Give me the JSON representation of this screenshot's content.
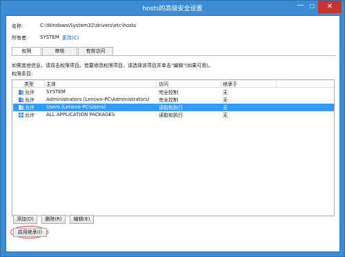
{
  "window": {
    "title": "hosts的高级安全设置",
    "close_label": "✕",
    "min_label": "—",
    "max_label": "☐"
  },
  "header": {
    "name_label": "名称:",
    "name_value": "C:\\Windows\\System32\\drivers\\etc\\hosts",
    "owner_label": "所有者:",
    "owner_value": "SYSTEM",
    "change_link": "更改(C)"
  },
  "tabs": [
    {
      "label": "权限"
    },
    {
      "label": "审核"
    },
    {
      "label": "有效访问"
    }
  ],
  "info_text": "如需其他信息，请双击权限项目。若要修改权限项目，请选择该项目并单击\"编辑\"(如果可用)。",
  "entries_label": "权限条目:",
  "columns": [
    "类型",
    "主体",
    "访问",
    "继承于"
  ],
  "rows": [
    {
      "type": "允许",
      "principal": "SYSTEM",
      "access": "完全控制",
      "inherited": "无"
    },
    {
      "type": "允许",
      "principal": "Administrators (Lenovo-PC\\Administrators)",
      "access": "完全控制",
      "inherited": "无"
    },
    {
      "type": "允许",
      "principal": "Users (Lenovo-PC\\Users)",
      "access": "读取和执行",
      "inherited": "无"
    },
    {
      "type": "允许",
      "principal": "ALL APPLICATION PACKAGES",
      "access": "读取和执行",
      "inherited": "无"
    }
  ],
  "selected_row": 2,
  "buttons": {
    "add": "添加(D)",
    "remove": "删除(R)",
    "edit": "编辑(E)",
    "enable_inheritance": "启用继承(I)"
  },
  "colors": {
    "titlebar": "#3c8dd3",
    "selection": "#3399ff",
    "link": "#1a5fc8",
    "annotation": "#e23b3b"
  }
}
